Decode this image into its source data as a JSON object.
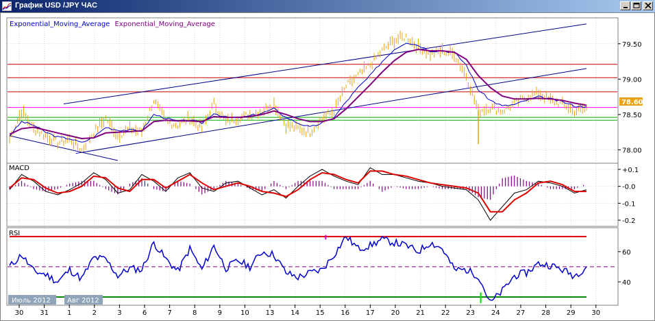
{
  "window": {
    "title": "График USD /JPY ЧАС",
    "buttons": [
      "minimize",
      "maximize",
      "close"
    ]
  },
  "colors": {
    "price": "#e8a317",
    "ema_fast": "#0000cc",
    "ema_slow": "#800080",
    "channel": "#00008b",
    "horizontal_red": "#cc0000",
    "horizontal_magenta": "#ff00ff",
    "horizontal_green": "#00aa00",
    "macd_line": "#000000",
    "macd_signal": "#dd0000",
    "macd_hist": "#800080",
    "rsi_line": "#0000cc",
    "rsi_upper": "#dd0000",
    "rsi_lower": "#008800",
    "price_badge": "#e8a317"
  },
  "chart_data": [
    {
      "type": "line",
      "panel": "price",
      "legend": [
        "Exponential_Moving_Average",
        "Exponential_Moving_Average"
      ],
      "ylim": [
        77.85,
        79.75
      ],
      "yticks": [
        "79.50",
        "79.00",
        "78.50",
        "78.00"
      ],
      "current_price": "78.60",
      "horizontal_levels": [
        {
          "value": 79.21,
          "color": "red"
        },
        {
          "value": 79.02,
          "color": "red"
        },
        {
          "value": 78.82,
          "color": "red"
        },
        {
          "value": 78.6,
          "color": "magenta"
        },
        {
          "value": 78.46,
          "color": "green"
        },
        {
          "value": 78.42,
          "color": "green"
        }
      ],
      "x": [
        0,
        1,
        2,
        3,
        4,
        5,
        6,
        7,
        8,
        9,
        10,
        11,
        12,
        13,
        14,
        15,
        16,
        17,
        18,
        19,
        20,
        21,
        22,
        23,
        24,
        25,
        26,
        27,
        28,
        29,
        30,
        31,
        32,
        33,
        34,
        35,
        36,
        37,
        38,
        39,
        40,
        41,
        42,
        43,
        44,
        45,
        46,
        47,
        48
      ],
      "series": [
        {
          "role": "price",
          "values": [
            78.15,
            78.55,
            78.3,
            78.2,
            78.1,
            78.15,
            78.0,
            78.25,
            78.45,
            78.2,
            78.3,
            78.25,
            78.7,
            78.4,
            78.35,
            78.45,
            78.3,
            78.65,
            78.4,
            78.45,
            78.5,
            78.55,
            78.65,
            78.35,
            78.3,
            78.25,
            78.45,
            78.55,
            78.9,
            79.05,
            79.2,
            79.4,
            79.55,
            79.6,
            79.45,
            79.35,
            79.4,
            79.35,
            79.05,
            78.55,
            78.6,
            78.55,
            78.65,
            78.75,
            78.8,
            78.7,
            78.65,
            78.55,
            78.6
          ]
        },
        {
          "role": "ema_fast",
          "values": [
            78.2,
            78.4,
            78.35,
            78.25,
            78.18,
            78.16,
            78.1,
            78.18,
            78.32,
            78.28,
            78.28,
            78.27,
            78.5,
            78.45,
            78.4,
            78.42,
            78.38,
            78.52,
            78.46,
            78.45,
            78.48,
            78.52,
            78.58,
            78.46,
            78.38,
            78.32,
            78.38,
            78.46,
            78.68,
            78.88,
            79.05,
            79.25,
            79.42,
            79.52,
            79.48,
            79.4,
            79.4,
            79.38,
            79.2,
            78.85,
            78.7,
            78.62,
            78.64,
            78.7,
            78.75,
            78.72,
            78.68,
            78.62,
            78.61
          ]
        },
        {
          "role": "ema_slow",
          "values": [
            78.22,
            78.3,
            78.32,
            78.28,
            78.24,
            78.2,
            78.16,
            78.17,
            78.24,
            78.25,
            78.26,
            78.27,
            78.4,
            78.42,
            78.41,
            78.41,
            78.4,
            78.47,
            78.46,
            78.46,
            78.47,
            78.5,
            78.55,
            78.5,
            78.44,
            78.4,
            78.4,
            78.44,
            78.58,
            78.75,
            78.92,
            79.1,
            79.26,
            79.38,
            79.42,
            79.4,
            79.4,
            79.38,
            79.28,
            79.05,
            78.88,
            78.76,
            78.72,
            78.72,
            78.73,
            78.72,
            78.7,
            78.66,
            78.63
          ]
        }
      ],
      "channel_lines": [
        {
          "from": [
            4.5,
            78.65
          ],
          "to": [
            48.0,
            79.78
          ]
        },
        {
          "from": [
            5.5,
            77.95
          ],
          "to": [
            48.0,
            79.15
          ]
        },
        {
          "from": [
            0,
            78.2
          ],
          "to": [
            9.0,
            77.85
          ]
        }
      ]
    },
    {
      "type": "line",
      "panel": "MACD",
      "legend": [
        "MACD"
      ],
      "ylim": [
        -0.22,
        0.12
      ],
      "yticks": [
        "+0.1",
        "-0.0",
        "-0.1",
        "-0.2"
      ],
      "x": [
        0,
        1,
        2,
        3,
        4,
        5,
        6,
        7,
        8,
        9,
        10,
        11,
        12,
        13,
        14,
        15,
        16,
        17,
        18,
        19,
        20,
        21,
        22,
        23,
        24,
        25,
        26,
        27,
        28,
        29,
        30,
        31,
        32,
        33,
        34,
        35,
        36,
        37,
        38,
        39,
        40,
        41,
        42,
        43,
        44,
        45,
        46,
        47,
        48
      ],
      "series": [
        {
          "role": "macd",
          "values": [
            -0.02,
            0.07,
            0.03,
            -0.03,
            -0.05,
            -0.02,
            0.02,
            0.08,
            0.04,
            -0.04,
            -0.02,
            0.07,
            0.03,
            -0.03,
            0.05,
            0.08,
            -0.01,
            -0.03,
            0.02,
            0.03,
            -0.01,
            -0.05,
            -0.02,
            -0.07,
            0.0,
            0.06,
            0.1,
            0.06,
            0.03,
            0.01,
            0.11,
            0.07,
            0.07,
            0.05,
            0.03,
            0.02,
            0.0,
            -0.01,
            -0.02,
            -0.08,
            -0.2,
            -0.12,
            -0.04,
            -0.02,
            0.03,
            0.02,
            0.0,
            -0.04,
            -0.02
          ]
        },
        {
          "role": "signal",
          "values": [
            -0.01,
            0.05,
            0.04,
            -0.01,
            -0.04,
            -0.03,
            0.0,
            0.06,
            0.05,
            -0.01,
            -0.03,
            0.04,
            0.04,
            -0.01,
            0.03,
            0.07,
            0.02,
            -0.02,
            0.0,
            0.02,
            0.0,
            -0.03,
            -0.04,
            -0.06,
            -0.02,
            0.04,
            0.08,
            0.07,
            0.04,
            0.02,
            0.09,
            0.09,
            0.07,
            0.06,
            0.04,
            0.02,
            0.01,
            0.0,
            -0.01,
            -0.04,
            -0.15,
            -0.15,
            -0.08,
            -0.04,
            0.02,
            0.03,
            0.01,
            -0.03,
            -0.03
          ]
        }
      ]
    },
    {
      "type": "line",
      "panel": "RSI",
      "legend": [
        "RSI"
      ],
      "ylim": [
        25,
        74
      ],
      "yticks": [
        "60",
        "40"
      ],
      "levels": [
        {
          "value": 70,
          "color": "red"
        },
        {
          "value": 50,
          "style": "dashed"
        },
        {
          "value": 30,
          "color": "green"
        }
      ],
      "x": [
        0,
        1,
        2,
        3,
        4,
        5,
        6,
        7,
        8,
        9,
        10,
        11,
        12,
        13,
        14,
        15,
        16,
        17,
        18,
        19,
        20,
        21,
        22,
        23,
        24,
        25,
        26,
        27,
        28,
        29,
        30,
        31,
        32,
        33,
        34,
        35,
        36,
        37,
        38,
        39,
        40,
        41,
        42,
        43,
        44,
        45,
        46,
        47,
        48
      ],
      "series": [
        {
          "role": "rsi",
          "values": [
            50,
            58,
            47,
            45,
            40,
            48,
            42,
            56,
            55,
            44,
            49,
            48,
            66,
            55,
            47,
            62,
            48,
            64,
            49,
            54,
            50,
            60,
            58,
            46,
            43,
            46,
            48,
            58,
            70,
            62,
            64,
            68,
            66,
            64,
            60,
            66,
            62,
            48,
            48,
            44,
            26,
            34,
            44,
            46,
            52,
            51,
            48,
            44,
            50
          ]
        }
      ]
    }
  ],
  "date_axis": {
    "labels": [
      "30",
      "31",
      "1",
      "2",
      "3",
      "6",
      "7",
      "8",
      "9",
      "10",
      "13",
      "14",
      "15",
      "16",
      "17",
      "20",
      "21",
      "22",
      "23",
      "24",
      "27",
      "28",
      "29",
      "30"
    ],
    "months": [
      "Июль 2012",
      "Авг 2012"
    ]
  }
}
